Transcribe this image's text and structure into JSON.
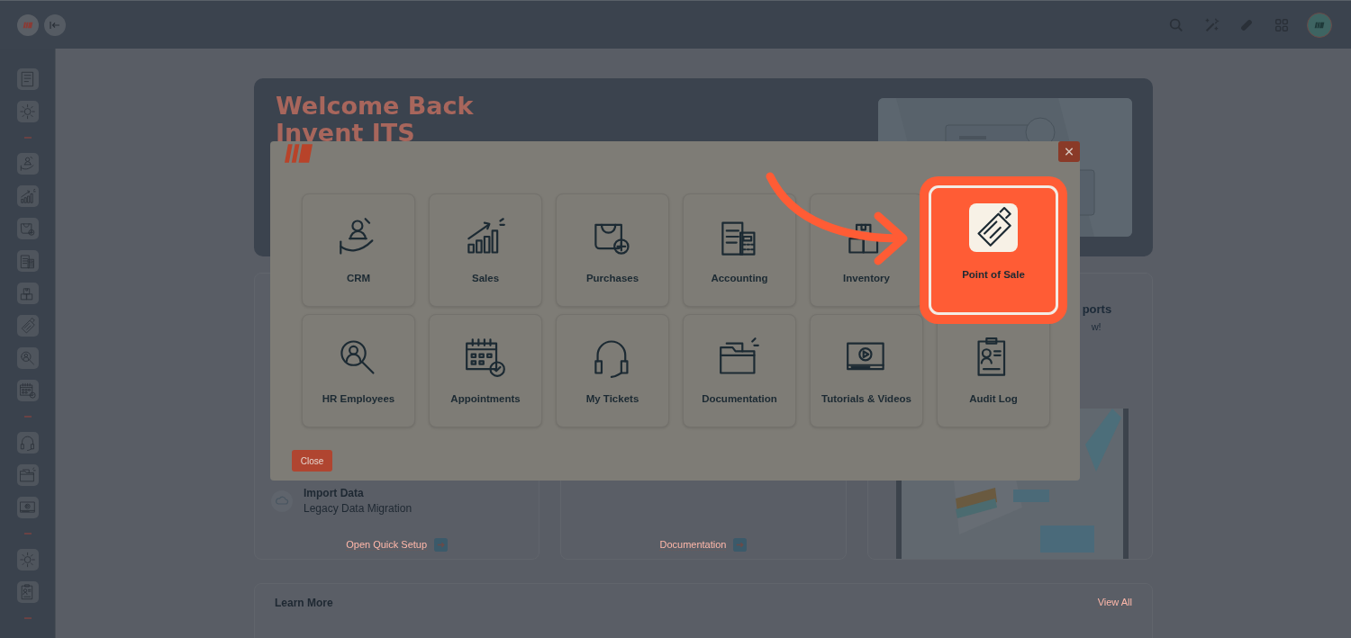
{
  "welcome": {
    "title": "Welcome Back",
    "subtitle": "Invent ITS"
  },
  "cards": [
    {
      "kind": "setup",
      "title": "Import Data",
      "subtitle": "Legacy Data Migration",
      "link": "Open Quick Setup"
    },
    {
      "kind": "docs",
      "link": "Documentation"
    },
    {
      "kind": "reports",
      "heading": "ports",
      "text": "w!"
    }
  ],
  "learn_more": {
    "title": "Learn More",
    "link": "View All"
  },
  "modal": {
    "apps": [
      {
        "label": "CRM",
        "selected": false
      },
      {
        "label": "Sales",
        "selected": false
      },
      {
        "label": "Purchases",
        "selected": false
      },
      {
        "label": "Accounting",
        "selected": false
      },
      {
        "label": "Inventory",
        "selected": false
      },
      {
        "label": "Point of Sale",
        "selected": true
      },
      {
        "label": "HR Employees",
        "selected": false
      },
      {
        "label": "Appointments",
        "selected": false
      },
      {
        "label": "My Tickets",
        "selected": false
      },
      {
        "label": "Documentation",
        "selected": false
      },
      {
        "label": "Tutorials & Videos",
        "selected": false
      },
      {
        "label": "Audit Log",
        "selected": false
      }
    ],
    "close_button": "Close"
  }
}
